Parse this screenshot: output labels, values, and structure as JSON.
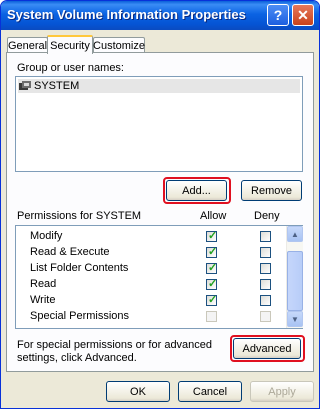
{
  "window": {
    "title": "System Volume Information Properties",
    "help_label": "?",
    "close_label": "✕"
  },
  "tabs": [
    {
      "label": "General"
    },
    {
      "label": "Security"
    },
    {
      "label": "Customize"
    }
  ],
  "security": {
    "group_label": "Group or user names:",
    "users": [
      {
        "name": "SYSTEM"
      }
    ],
    "add_label": "Add...",
    "remove_label": "Remove",
    "permissions_label": "Permissions for SYSTEM",
    "allow_header": "Allow",
    "deny_header": "Deny",
    "permissions": [
      {
        "name": "Modify",
        "allow": true,
        "deny": false,
        "disabled": false
      },
      {
        "name": "Read & Execute",
        "allow": true,
        "deny": false,
        "disabled": false
      },
      {
        "name": "List Folder Contents",
        "allow": true,
        "deny": false,
        "disabled": false
      },
      {
        "name": "Read",
        "allow": true,
        "deny": false,
        "disabled": false
      },
      {
        "name": "Write",
        "allow": true,
        "deny": false,
        "disabled": false
      },
      {
        "name": "Special Permissions",
        "allow": false,
        "deny": false,
        "disabled": true
      }
    ],
    "advanced_text": "For special permissions or for advanced settings, click Advanced.",
    "advanced_label": "Advanced"
  },
  "footer": {
    "ok_label": "OK",
    "cancel_label": "Cancel",
    "apply_label": "Apply"
  },
  "colors": {
    "highlight": "#e01020",
    "titlebar": "#0b63e3",
    "check": "#21a121"
  }
}
